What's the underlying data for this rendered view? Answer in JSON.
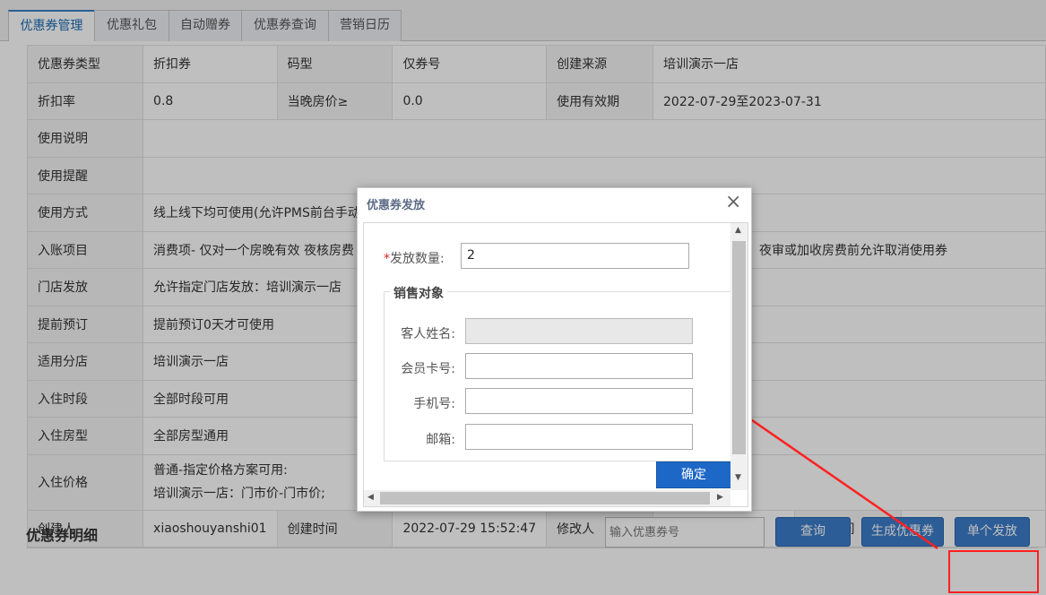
{
  "tabs": [
    "优惠券管理",
    "优惠礼包",
    "自动赠券",
    "优惠券查询",
    "营销日历"
  ],
  "info_rows": [
    [
      "优惠券类型",
      "折扣券",
      "码型",
      "仅券号",
      "创建来源",
      "培训演示一店"
    ],
    [
      "折扣率",
      "0.8",
      "当晚房价≥",
      "0.0",
      "使用有效期",
      "2022-07-29至2023-07-31"
    ],
    [
      "使用说明",
      ""
    ],
    [
      "使用提醒",
      ""
    ],
    [
      "使用方式",
      "线上线下均可使用(允许PMS前台手动"
    ],
    [
      "入账项目",
      "消费项- 仅对一个房晚有效 夜核房费",
      "夜审或加收房费前允许取消使用券"
    ],
    [
      "门店发放",
      "允许指定门店发放：培训演示一店"
    ],
    [
      "提前预订",
      "提前预订0天才可使用"
    ],
    [
      "适用分店",
      "培训演示一店"
    ],
    [
      "入住时段",
      "全部时段可用"
    ],
    [
      "入住房型",
      "全部房型通用"
    ],
    [
      "入住价格",
      "普通-指定价格方案可用:",
      "培训演示一店：门市价-门市价;"
    ],
    [
      "创建人",
      "xiaoshouyanshi01",
      "创建时间",
      "2022-07-29 15:52:47",
      "修改人",
      "",
      "修改时间",
      ""
    ]
  ],
  "detail": {
    "title": "优惠券明细",
    "search_placeholder": "输入优惠券号",
    "query_button": "查询",
    "generate_button": "生成优惠券",
    "issue_button": "单个发放"
  },
  "dialog": {
    "title": "优惠券发放",
    "close": "×",
    "required_mark": "*",
    "quantity_label": "发放数量:",
    "quantity_value": "2",
    "section_label": "销售对象",
    "guest_name_label": "客人姓名:",
    "member_card_label": "会员卡号:",
    "phone_label": "手机号:",
    "email_label": "邮箱:",
    "confirm": "确定"
  },
  "colors": {
    "accent": "#1d68c7",
    "annotation": "#ff2020"
  }
}
